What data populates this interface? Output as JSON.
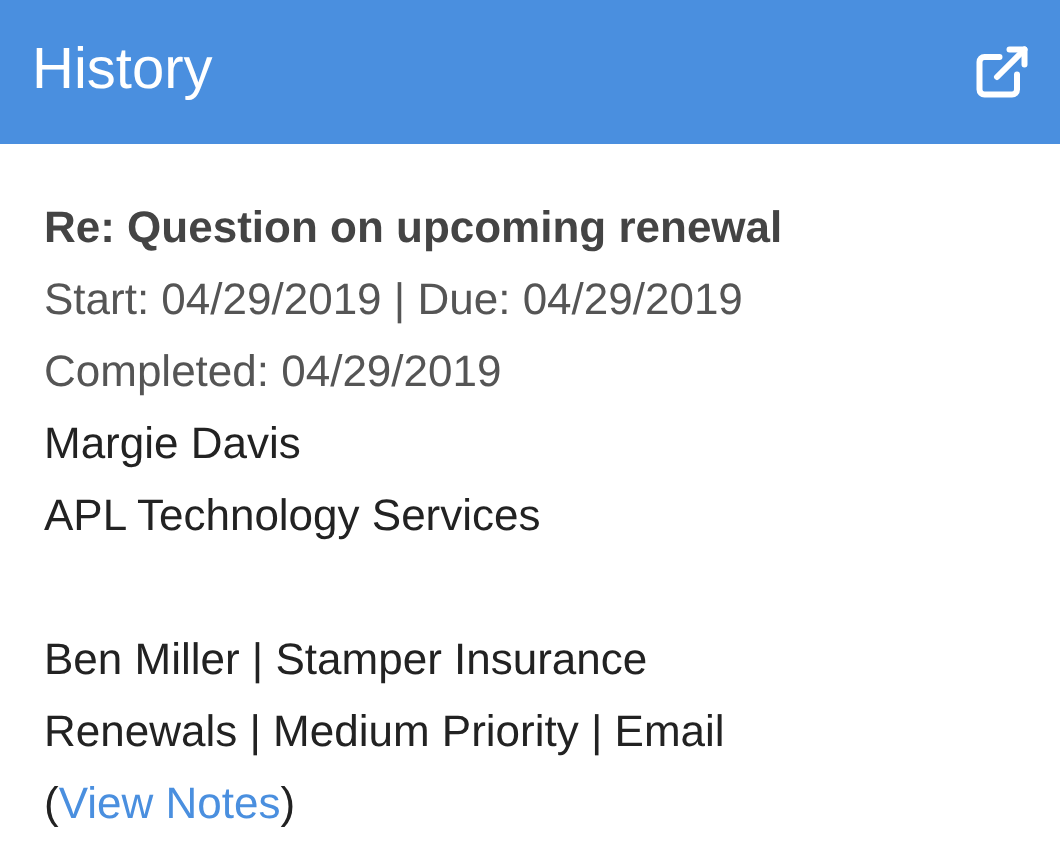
{
  "header": {
    "title": "History"
  },
  "activity": {
    "subject": "Re: Question on upcoming renewal",
    "dates": "Start: 04/29/2019 | Due: 04/29/2019",
    "completed": "Completed: 04/29/2019",
    "contact": "Margie Davis",
    "company": "APL Technology Services",
    "owner": "Ben Miller | Stamper Insurance",
    "details": "Renewals | Medium Priority | Email",
    "notes_prefix": "(",
    "notes_link": "View Notes",
    "notes_suffix": ")"
  }
}
